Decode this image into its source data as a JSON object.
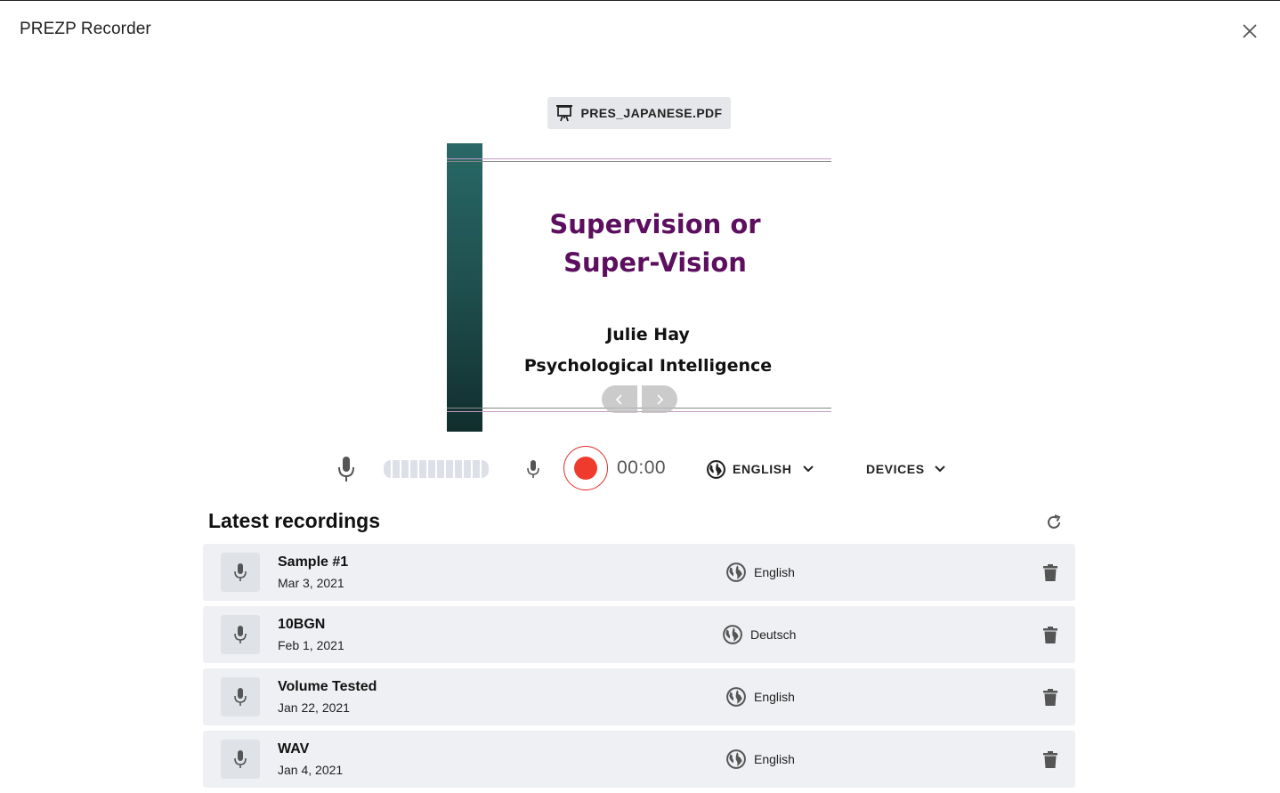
{
  "app": {
    "title": "PREZP Recorder"
  },
  "file": {
    "name": "PRES_JAPANESE.PDF"
  },
  "slide": {
    "title_line1": "Supervision or",
    "title_line2": "Super-Vision",
    "author": "Julie Hay",
    "organization": "Psychological Intelligence"
  },
  "recorder": {
    "timer": "00:00",
    "language": "ENGLISH",
    "devices": "DEVICES"
  },
  "recordings": {
    "heading": "Latest recordings",
    "items": [
      {
        "name": "Sample #1",
        "date": "Mar 3, 2021",
        "language": "English"
      },
      {
        "name": "10BGN",
        "date": "Feb 1, 2021",
        "language": "Deutsch"
      },
      {
        "name": "Volume Tested",
        "date": "Jan 22, 2021",
        "language": "English"
      },
      {
        "name": "WAV",
        "date": "Jan 4, 2021",
        "language": "English"
      }
    ]
  },
  "colors": {
    "record": "#ef3b2d",
    "slide_title": "#5c0f5e",
    "slide_bar": "#286866",
    "row_background": "#eef0f3"
  },
  "icons": [
    "close-icon",
    "presentation-icon",
    "microphone-icon",
    "globe-icon",
    "chevron-down-icon",
    "refresh-icon",
    "trash-icon",
    "chevron-left-icon",
    "chevron-right-icon"
  ]
}
